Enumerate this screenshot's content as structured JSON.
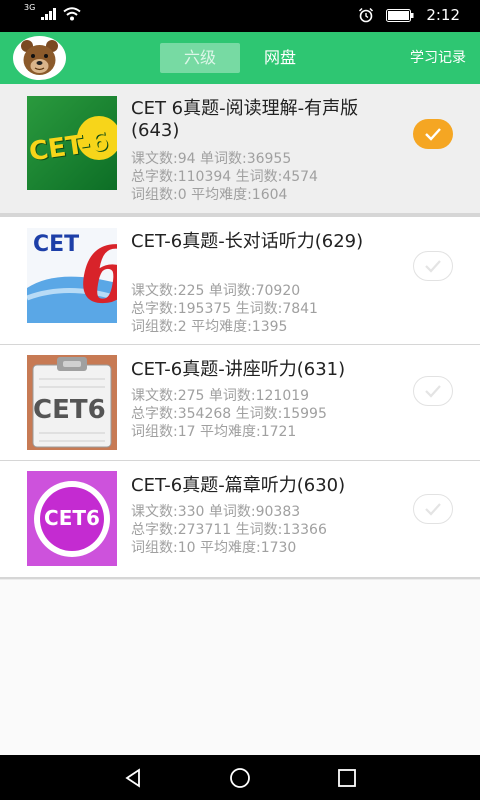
{
  "status_bar": {
    "network": "3G",
    "time": "2:12"
  },
  "header": {
    "tabs": [
      {
        "label": "六级",
        "active": true
      },
      {
        "label": "网盘",
        "active": false
      }
    ],
    "study_record": "学习记录"
  },
  "items": [
    {
      "title": "CET 6真题-阅读理解-有声版(643)",
      "stats": [
        "课文数:94 单词数:36955",
        "总字数:110394 生词数:4574",
        "词组数:0 平均难度:1604"
      ],
      "thumb_text": "CET-6",
      "selected": true
    },
    {
      "title": "CET-6真题-长对话听力(629)",
      "stats": [
        "课文数:225 单词数:70920",
        "总字数:195375 生词数:7841",
        "词组数:2 平均难度:1395"
      ],
      "thumb_text_top": "CET",
      "thumb_text_big": "6",
      "selected": false
    },
    {
      "title": "CET-6真题-讲座听力(631)",
      "stats": [
        "课文数:275 单词数:121019",
        "总字数:354268 生词数:15995",
        "词组数:17 平均难度:1721"
      ],
      "thumb_text": "CET6",
      "selected": false
    },
    {
      "title": "CET-6真题-篇章听力(630)",
      "stats": [
        "课文数:330 单词数:90383",
        "总字数:273711 生词数:13366",
        "词组数:10 平均难度:1730"
      ],
      "thumb_text": "CET6",
      "selected": false
    }
  ],
  "colors": {
    "accent": "#2ec672",
    "check_on": "#f5a623"
  }
}
